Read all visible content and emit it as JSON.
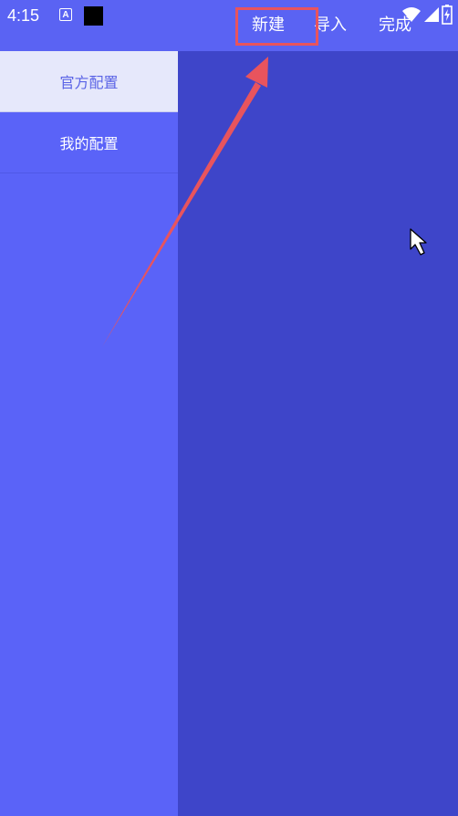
{
  "status_bar": {
    "time": "4:15",
    "letter_icon": "A"
  },
  "toolbar": {
    "new_label": "新建",
    "import_label": "导入",
    "done_label": "完成"
  },
  "sidebar": {
    "items": [
      {
        "label": "官方配置",
        "active": true
      },
      {
        "label": "我的配置",
        "active": false
      }
    ]
  },
  "colors": {
    "app_bar": "#5a63f3",
    "sidebar": "#5a63f8",
    "content": "#3e45c9",
    "active_item_bg": "#e6e8fb",
    "active_item_text": "#5a63e6",
    "annotation": "#e8545d"
  },
  "icons": [
    "wifi-icon",
    "signal-icon",
    "battery-icon",
    "mouse-cursor-icon",
    "arrow-annotation-icon"
  ]
}
